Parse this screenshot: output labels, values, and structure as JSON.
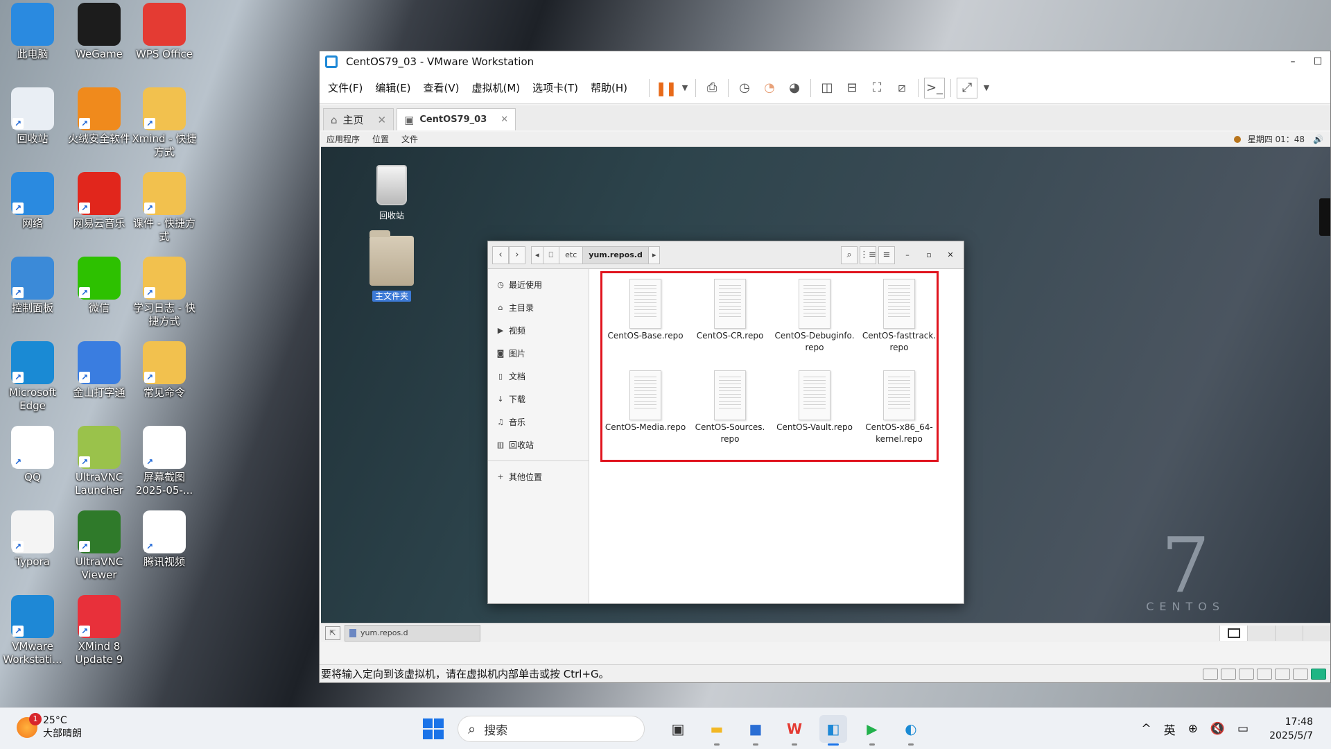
{
  "desktop": {
    "icons": [
      {
        "label": "此电脑",
        "icon": "computer-icon",
        "color": "#2a8ae0"
      },
      {
        "label": "WeGame",
        "icon": "wegame-icon",
        "color": "#1c1c1c"
      },
      {
        "label": "WPS Office",
        "icon": "wps-icon",
        "color": "#e43b33"
      },
      {
        "label": "回收站",
        "icon": "recycle-bin-icon",
        "color": "#e9eef4"
      },
      {
        "label": "火绒安全软件",
        "icon": "huorong-icon",
        "color": "#f08a1c"
      },
      {
        "label": "Xmind - 快捷方式",
        "icon": "folder-icon",
        "color": "#f2c14e"
      },
      {
        "label": "网络",
        "icon": "network-icon",
        "color": "#2a8ae0"
      },
      {
        "label": "网易云音乐",
        "icon": "netease-music-icon",
        "color": "#e1261c"
      },
      {
        "label": "课件 - 快捷方式",
        "icon": "folder-icon",
        "color": "#f2c14e"
      },
      {
        "label": "控制面板",
        "icon": "control-panel-icon",
        "color": "#3b8ad8"
      },
      {
        "label": "微信",
        "icon": "wechat-icon",
        "color": "#2dc100"
      },
      {
        "label": "学习日志 - 快捷方式",
        "icon": "folder-icon",
        "color": "#f2c14e"
      },
      {
        "label": "Microsoft Edge",
        "icon": "edge-icon",
        "color": "#1a8ad4"
      },
      {
        "label": "金山打字通",
        "icon": "kingsoft-typing-icon",
        "color": "#3a7de0"
      },
      {
        "label": "常见命令",
        "icon": "folder-icon",
        "color": "#f2c14e"
      },
      {
        "label": "QQ",
        "icon": "qq-icon",
        "color": "#ffffff"
      },
      {
        "label": "UltraVNC Launcher",
        "icon": "ultravnc-launcher-icon",
        "color": "#9ac24b"
      },
      {
        "label": "屏幕截图 2025-05-...",
        "icon": "screenshot-file-icon",
        "color": "#ffffff"
      },
      {
        "label": "Typora",
        "icon": "typora-icon",
        "color": "#f4f4f4"
      },
      {
        "label": "UltraVNC Viewer",
        "icon": "ultravnc-viewer-icon",
        "color": "#2f7a2a"
      },
      {
        "label": "腾讯视频",
        "icon": "tencent-video-icon",
        "color": "#ffffff"
      },
      {
        "label": "VMware Workstati...",
        "icon": "vmware-icon",
        "color": "#1e88d6"
      },
      {
        "label": "XMind 8 Update 9",
        "icon": "xmind-icon",
        "color": "#e8303a"
      }
    ]
  },
  "vmware": {
    "title": "CentOS79_03 - VMware Workstation",
    "win_min": "–",
    "win_max": "☐",
    "menu": [
      "文件(F)",
      "编辑(E)",
      "查看(V)",
      "虚拟机(M)",
      "选项卡(T)",
      "帮助(H)"
    ],
    "tabs": [
      {
        "label": "主页",
        "close": "✕"
      },
      {
        "label": "CentOS79_03",
        "close": "✕"
      }
    ],
    "status_text": "要将输入定向到该虚拟机，请在虚拟机内部单击或按 Ctrl+G。"
  },
  "guest": {
    "topbar": {
      "apps": "应用程序",
      "places": "位置",
      "files": "文件",
      "clock": "星期四 01：48",
      "volume": "🔊"
    },
    "desktop_trash": "回收站",
    "desktop_home": "主文件夹",
    "logo_seven": "7",
    "logo_word": "CENTOS",
    "taskbar_item": "yum.repos.d"
  },
  "nautilus": {
    "breadcrumbs": [
      "etc",
      "yum.repos.d"
    ],
    "sidebar": [
      {
        "label": "最近使用",
        "icon": "◷"
      },
      {
        "label": "主目录",
        "icon": "⌂"
      },
      {
        "label": "视频",
        "icon": "▶"
      },
      {
        "label": "图片",
        "icon": "◙"
      },
      {
        "label": "文档",
        "icon": "▯"
      },
      {
        "label": "下载",
        "icon": "↓"
      },
      {
        "label": "音乐",
        "icon": "♫"
      },
      {
        "label": "回收站",
        "icon": "▥"
      },
      {
        "label": "其他位置",
        "icon": "+"
      }
    ],
    "files": [
      {
        "line1": "CentOS-Base.repo",
        "line2": ""
      },
      {
        "line1": "CentOS-CR.repo",
        "line2": ""
      },
      {
        "line1": "CentOS-Debuginfo.",
        "line2": "repo"
      },
      {
        "line1": "CentOS-fasttrack.",
        "line2": "repo"
      },
      {
        "line1": "CentOS-Media.repo",
        "line2": ""
      },
      {
        "line1": "CentOS-Sources.",
        "line2": "repo"
      },
      {
        "line1": "CentOS-Vault.repo",
        "line2": ""
      },
      {
        "line1": "CentOS-x86_64-",
        "line2": "kernel.repo"
      }
    ],
    "highlight_color": "#e0141e"
  },
  "taskbar": {
    "weather_temp": "25°C",
    "weather_desc": "大部晴朗",
    "weather_badge": "1",
    "search_placeholder": "搜索",
    "apps": [
      {
        "name": "task-view-icon",
        "glyph": "▣",
        "color": "#333333"
      },
      {
        "name": "file-explorer-icon",
        "glyph": "▬",
        "color": "#f2b825"
      },
      {
        "name": "microsoft-store-icon",
        "glyph": "■",
        "color": "#2a6ed4"
      },
      {
        "name": "wps-icon",
        "glyph": "W",
        "color": "#e43b33"
      },
      {
        "name": "vmware-icon",
        "glyph": "◧",
        "color": "#1e88d6"
      },
      {
        "name": "tencent-video-icon",
        "glyph": "▶",
        "color": "#22b14c"
      },
      {
        "name": "edge-icon",
        "glyph": "◐",
        "color": "#1a8ad4"
      }
    ],
    "tray": {
      "chevron": "^",
      "ime": "英",
      "globe": "⊕",
      "mute": "🔇",
      "battery": "▭"
    },
    "time": "17:48",
    "date": "2025/5/7"
  }
}
